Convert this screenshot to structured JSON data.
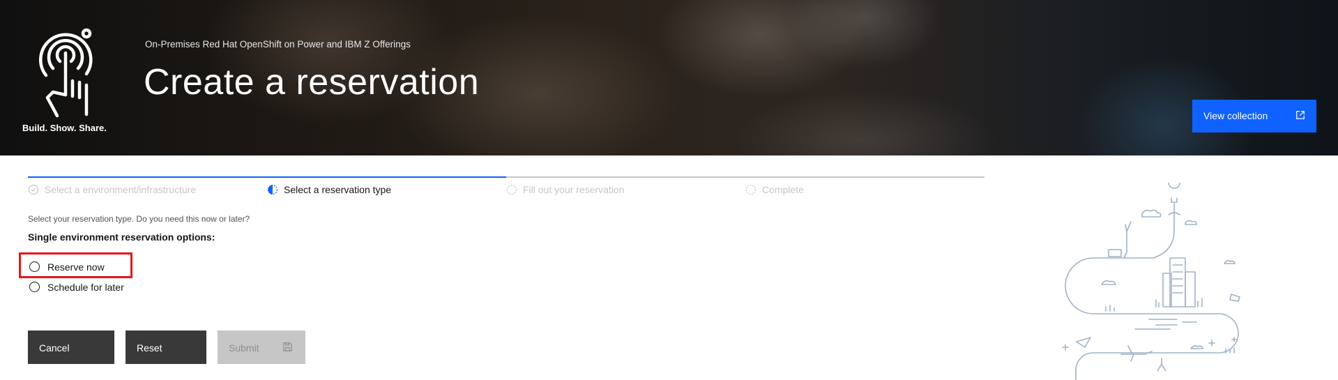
{
  "header": {
    "logo_text": "Build. Show. Share.",
    "eyebrow": "On-Premises Red Hat OpenShift on Power and IBM Z Offerings",
    "title": "Create a reservation",
    "view_collection_label": "View collection"
  },
  "progress": {
    "steps": [
      {
        "label": "Select a environment/infrastructure",
        "state": "complete"
      },
      {
        "label": "Select a reservation type",
        "state": "current"
      },
      {
        "label": "Fill out your reservation",
        "state": "incomplete"
      },
      {
        "label": "Complete",
        "state": "incomplete"
      }
    ]
  },
  "form": {
    "prompt": "Select your reservation type. Do you need this now or later?",
    "options_heading": "Single environment reservation options:",
    "options": [
      {
        "label": "Reserve now",
        "selected": false
      },
      {
        "label": "Schedule for later",
        "selected": false
      }
    ]
  },
  "actions": {
    "cancel_label": "Cancel",
    "reset_label": "Reset",
    "submit_label": "Submit"
  },
  "colors": {
    "primary": "#0f62fe",
    "button_dark": "#393939",
    "disabled": "#c6c6c6",
    "highlight": "#e8141b"
  }
}
